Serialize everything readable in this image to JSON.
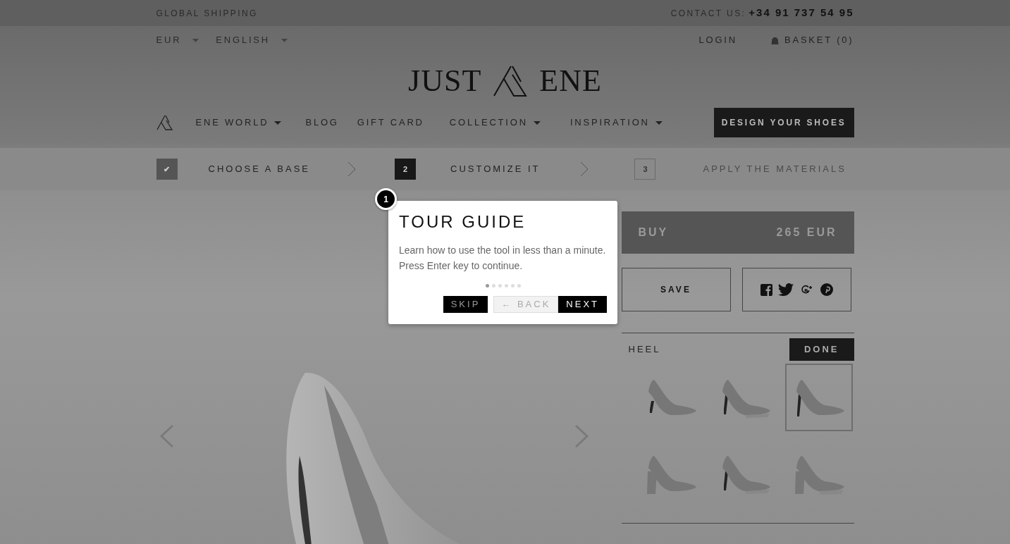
{
  "top_bar": {
    "shipping": "GLOBAL SHIPPING",
    "contact_label": "CONTACT US:",
    "phone": "+34 91 737 54 95"
  },
  "selectors": [
    {
      "label": "EUR"
    },
    {
      "label": "ENGLISH"
    }
  ],
  "account": {
    "login": "LOGIN",
    "basket": "BASKET (0)"
  },
  "logo": {
    "left": "JUST",
    "right": "ENE"
  },
  "nav": {
    "items": [
      {
        "label": "ENE WORLD",
        "dropdown": true
      },
      {
        "label": "BLOG",
        "dropdown": false
      },
      {
        "label": "GIFT CARD",
        "dropdown": false
      },
      {
        "label": "COLLECTION",
        "dropdown": true
      },
      {
        "label": "INSPIRATION",
        "dropdown": true
      }
    ],
    "cta": "DESIGN YOUR SHOES"
  },
  "steps": [
    {
      "marker": "✔",
      "label": "CHOOSE A BASE",
      "done": true,
      "selected": false
    },
    {
      "marker": "2",
      "label": "CUSTOMIZE IT",
      "done": false,
      "selected": true
    },
    {
      "marker": "3",
      "label": "APPLY THE MATERIALS",
      "done": false,
      "selected": false
    }
  ],
  "buy": {
    "label": "BUY",
    "price": "265 EUR"
  },
  "save": "SAVE",
  "section": {
    "title": "HEEL",
    "button": "DONE"
  },
  "thumbnails": [
    {
      "kind": "kitten",
      "selected": false
    },
    {
      "kind": "platform",
      "selected": false
    },
    {
      "kind": "stiletto",
      "selected": true
    },
    {
      "kind": "block",
      "selected": false
    },
    {
      "kind": "platform",
      "selected": false
    },
    {
      "kind": "block-platform",
      "selected": false
    }
  ],
  "tour": {
    "step": "1",
    "title": "TOUR GUIDE",
    "body": [
      "Learn how to use the tool in less than a minute.",
      "Press Enter key to continue."
    ],
    "dots": [
      {
        "selected": true
      },
      {
        "selected": false
      },
      {
        "selected": false
      },
      {
        "selected": false
      },
      {
        "selected": false
      },
      {
        "selected": false
      }
    ],
    "skip": "SKIP",
    "back": "← BACK",
    "next": "NEXT"
  }
}
